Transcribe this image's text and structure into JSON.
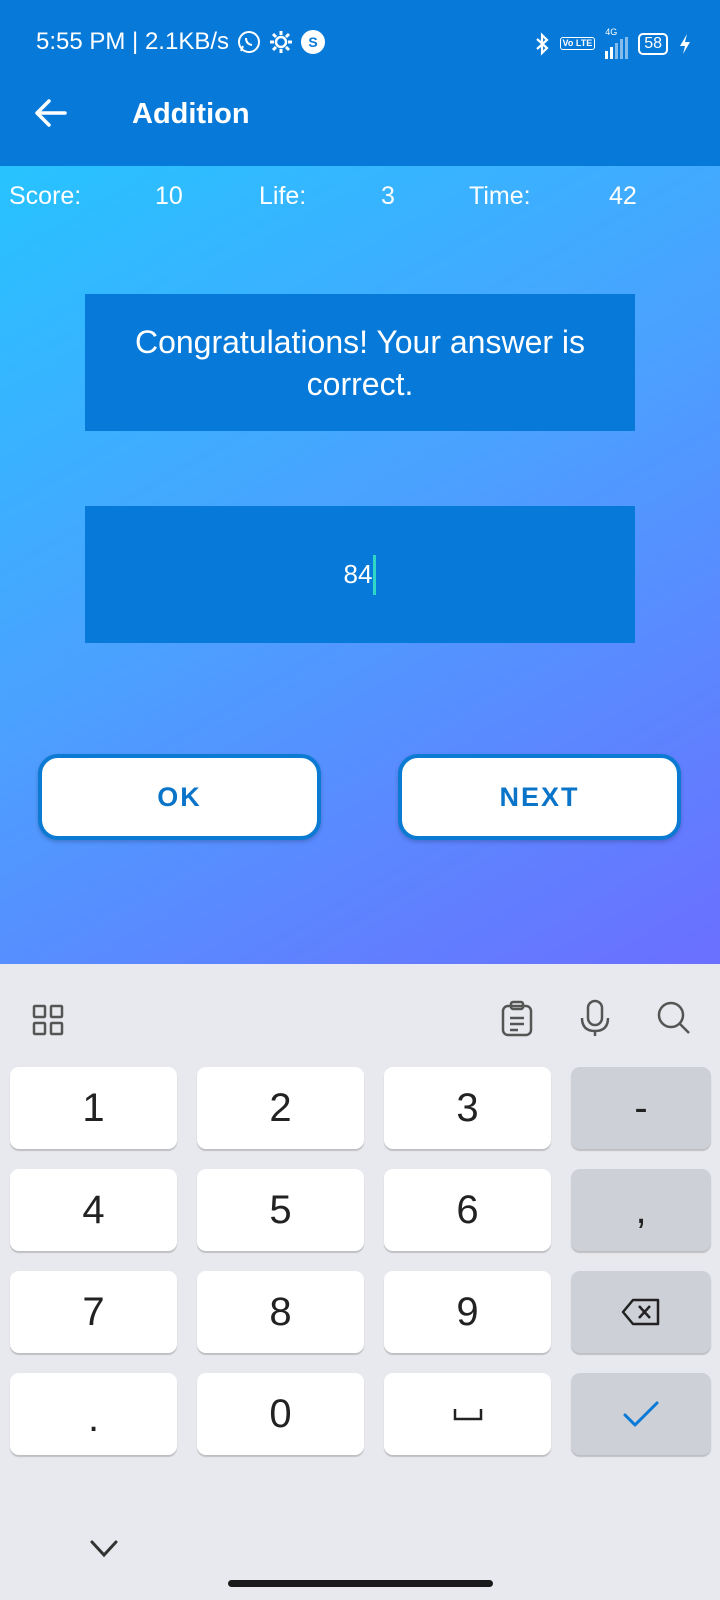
{
  "status_bar": {
    "time_speed": "5:55 PM | 2.1KB/s",
    "network": "4G",
    "volte": "Vo LTE",
    "battery": "58"
  },
  "app_bar": {
    "title": "Addition"
  },
  "stats": {
    "score_label": "Score:",
    "score_value": "10",
    "life_label": "Life:",
    "life_value": "3",
    "time_label": "Time:",
    "time_value": "42"
  },
  "message": "Congratulations! Your answer is correct.",
  "answer_input": {
    "value": "84"
  },
  "buttons": {
    "ok": "OK",
    "next": "NEXT"
  },
  "keyboard": {
    "rows": [
      [
        "1",
        "2",
        "3",
        "-"
      ],
      [
        "4",
        "5",
        "6",
        ","
      ],
      [
        "7",
        "8",
        "9",
        "backspace-icon"
      ],
      [
        ".",
        "0",
        "space-icon",
        "check-icon"
      ]
    ],
    "accent": "#0779d8"
  },
  "colors": {
    "app_bar": "#0779d8",
    "gradient_start": "#27c3ff",
    "gradient_end": "#6b6fff",
    "caret": "#2fd7c4"
  }
}
